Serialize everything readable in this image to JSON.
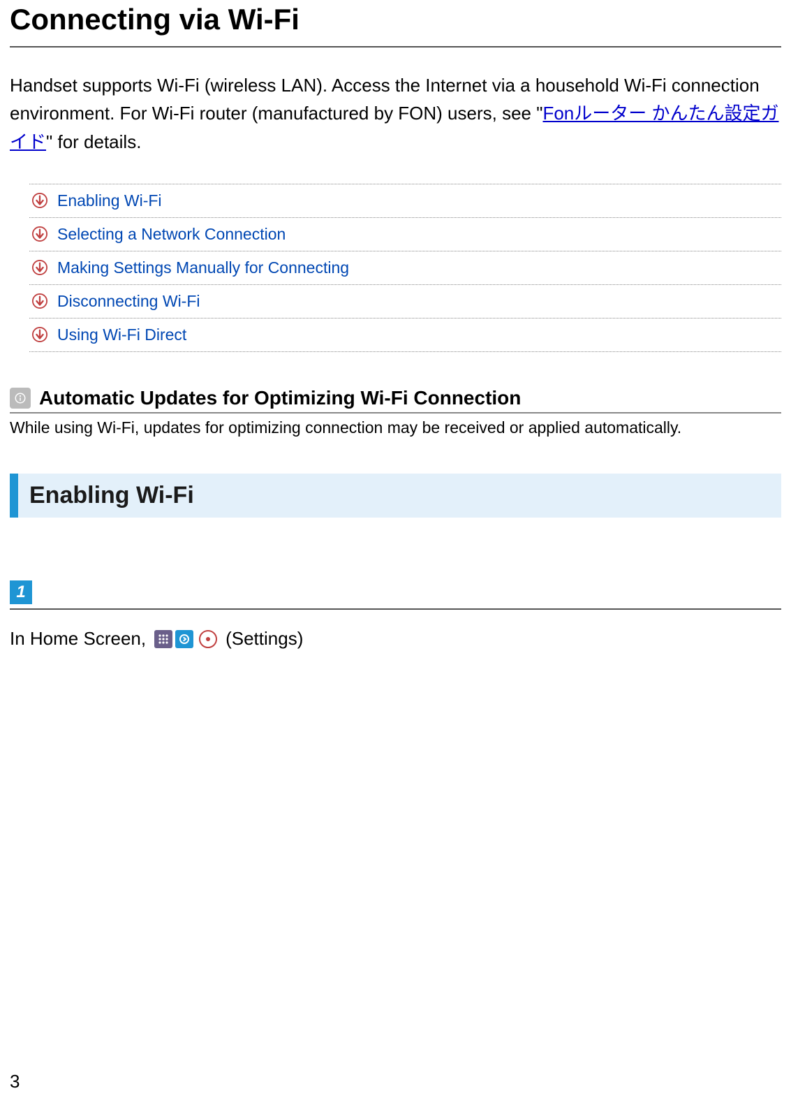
{
  "title": "Connecting via Wi-Fi",
  "intro": {
    "pre": "Handset supports Wi-Fi (wireless LAN). Access the Internet via a household Wi-Fi connection environment. For Wi-Fi router (manufactured by FON) users, see \"",
    "link": "Fonルーター かんたん設定ガイド",
    "post": "\" for details."
  },
  "toc": [
    {
      "label": "Enabling Wi-Fi"
    },
    {
      "label": "Selecting a Network Connection"
    },
    {
      "label": "Making Settings Manually for Connecting"
    },
    {
      "label": "Disconnecting Wi-Fi"
    },
    {
      "label": "Using Wi-Fi Direct"
    }
  ],
  "note": {
    "title": "Automatic Updates for Optimizing Wi-Fi Connection",
    "body": "While using Wi-Fi, updates for optimizing connection may be received or applied automatically."
  },
  "section1": {
    "heading": "Enabling Wi-Fi",
    "step_number": "1",
    "step_text_pre": "In Home Screen,",
    "step_text_post": "(Settings)"
  },
  "page_number": "3"
}
